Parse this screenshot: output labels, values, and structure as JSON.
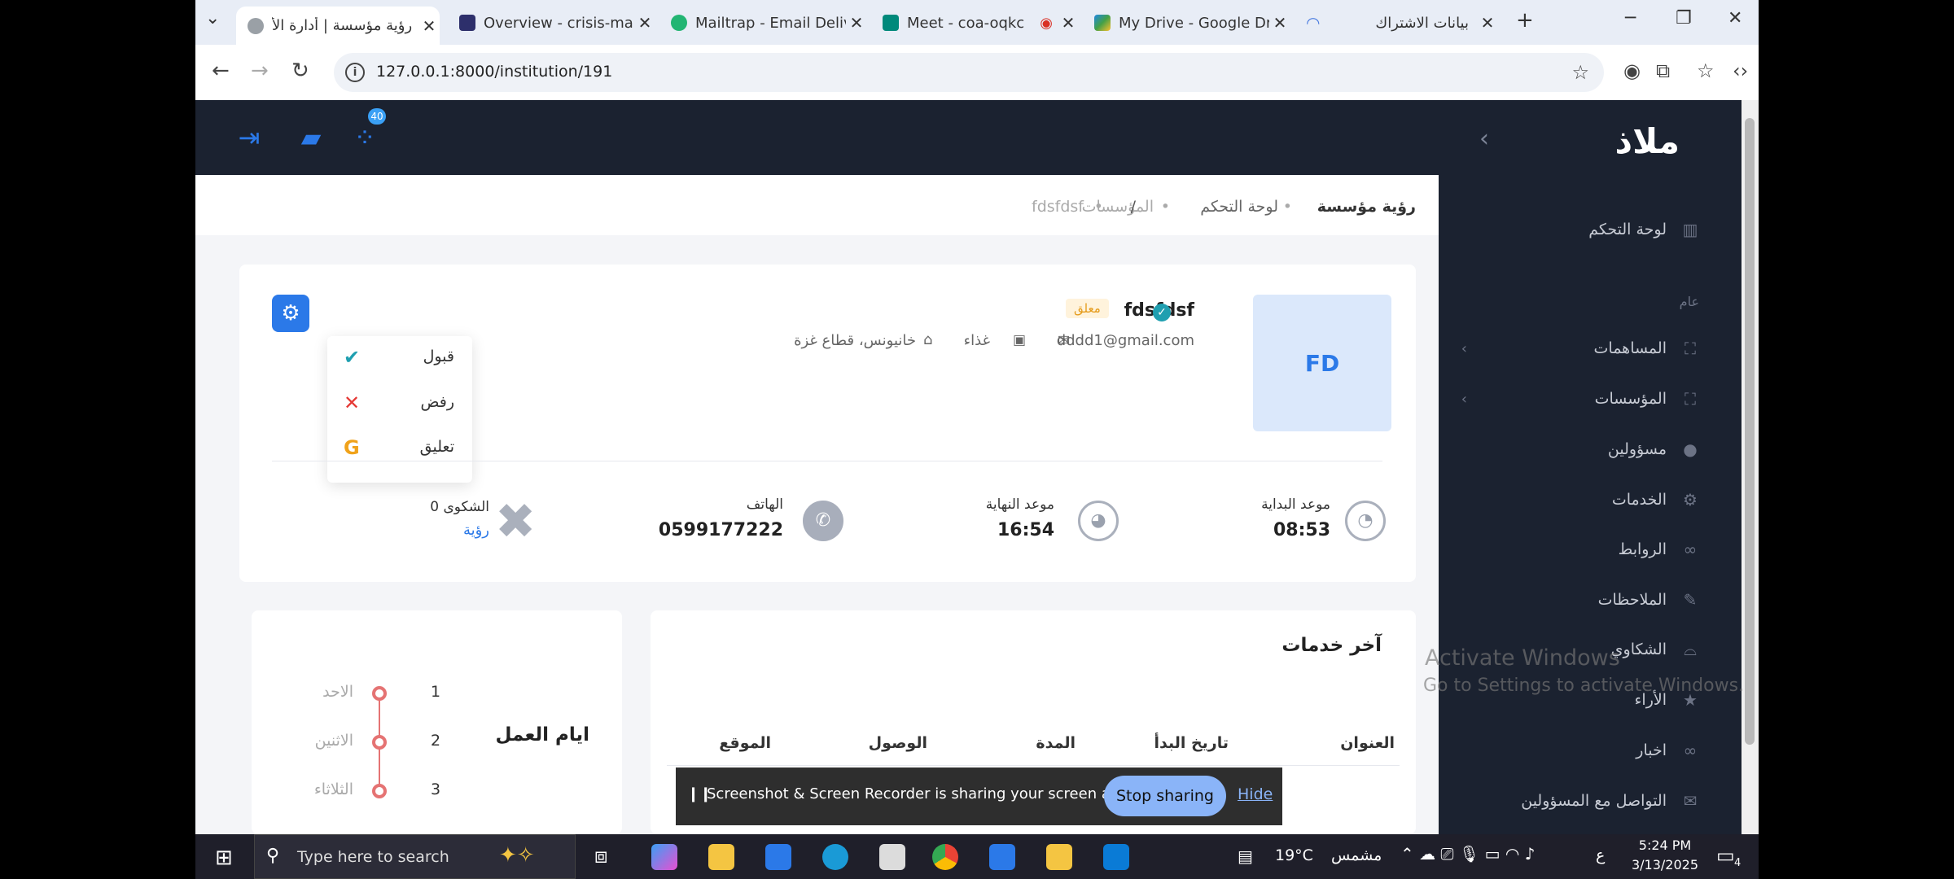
{
  "browser": {
    "tabs": [
      {
        "title": "رؤية مؤسسة | أدارة الأ",
        "active": true
      },
      {
        "title": "Overview - crisis-man"
      },
      {
        "title": "Mailtrap - Email Deliv"
      },
      {
        "title": "Meet - coa-oqkc"
      },
      {
        "title": "My Drive - Google Dr"
      },
      {
        "title": "بيانات الاشتراك"
      }
    ],
    "url": "127.0.0.1:8000/institution/191"
  },
  "app": {
    "logo": "ملاذ",
    "notification_count": "40",
    "sidebar": {
      "dashboard": "لوحة التحكم",
      "section_general": "عام",
      "items": [
        {
          "label": "المساهمات",
          "icon": "expand-icon",
          "has_chevron": true
        },
        {
          "label": "المؤسسات",
          "icon": "expand-icon",
          "has_chevron": true
        },
        {
          "label": "مسؤولين",
          "icon": "user-icon"
        },
        {
          "label": "الخدمات",
          "icon": "gear-icon"
        },
        {
          "label": "الروابط",
          "icon": "link-icon"
        },
        {
          "label": "الملاحظات",
          "icon": "pencil-icon"
        },
        {
          "label": "الشكاوي",
          "icon": "hat-icon"
        },
        {
          "label": "الأراء",
          "icon": "star-icon"
        },
        {
          "label": "اخبار",
          "icon": "glasses-icon"
        },
        {
          "label": "التواصل مع المسؤولين",
          "icon": "mail-icon"
        }
      ]
    },
    "breadcrumb": {
      "title": "رؤية مؤسسة",
      "dashboard": "لوحة التحكم",
      "institutions": "المؤسسات",
      "sep": "/",
      "current": "fdsfdsf"
    },
    "institution": {
      "avatar_initials": "FD",
      "name": "fdsfdsf",
      "status": "معلق",
      "email": "dddd1@gmail.com",
      "category": "غذاء",
      "location": "خانيونس، قطاع غزة"
    },
    "status_menu": {
      "accept": "قبول",
      "reject": "رفض",
      "suspend": "تعليق"
    },
    "stats": {
      "start_label": "موعد البداية",
      "start_value": "08:53",
      "end_label": "موعد النهاية",
      "end_value": "16:54",
      "phone_label": "الهاتف",
      "phone_value": "0599177222",
      "complaints_label": "0 الشكوى",
      "complaints_link": "رؤية"
    },
    "services": {
      "title": "آخر خدمات",
      "columns": [
        "العنوان",
        "تاريخ البدأ",
        "المدة",
        "الوصول",
        "الموقع"
      ]
    },
    "working_days": {
      "title": "ايام العمل",
      "days": [
        {
          "num": "1",
          "day": "الاحد"
        },
        {
          "num": "2",
          "day": "الاثنين"
        },
        {
          "num": "3",
          "day": "الثلاثاء"
        }
      ]
    }
  },
  "overlays": {
    "activate_title": "Activate Windows",
    "activate_sub": "Go to Settings to activate Windows.",
    "share_text": "Screenshot & Screen Recorder is sharing your screen and audio.",
    "stop_sharing": "Stop sharing",
    "hide": "Hide"
  },
  "taskbar": {
    "search_placeholder": "Type here to search",
    "weather_temp": "19°C",
    "weather_text": "مشمس",
    "lang": "ع",
    "time": "5:24 PM",
    "date": "3/13/2025",
    "notif_count": "4"
  }
}
